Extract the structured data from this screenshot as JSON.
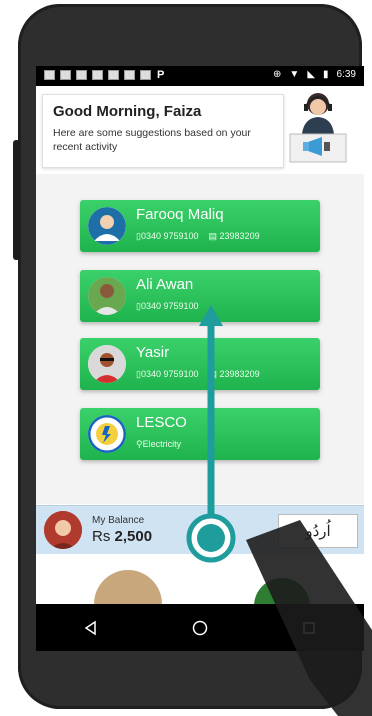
{
  "status_bar": {
    "time": "6:39"
  },
  "greeting": {
    "title": "Good Morning, Faiza",
    "subtitle": "Here are some suggestions based on your recent activity"
  },
  "contacts": [
    {
      "name": "Farooq Maliq",
      "phone": "0340 9759100",
      "account": "23983209"
    },
    {
      "name": "Ali Awan",
      "phone": "0340 9759100",
      "account": ""
    },
    {
      "name": "Yasir",
      "phone": "0340 9759100",
      "account": "23983209"
    },
    {
      "name": "LESCO",
      "category": "Electricity"
    }
  ],
  "balance": {
    "label": "My Balance",
    "currency": "Rs",
    "amount": "2,500"
  },
  "language_button": {
    "label": "اُردُو"
  },
  "nav": {
    "back": "back-icon",
    "home": "home-icon",
    "recents": "recents-icon"
  },
  "colors": {
    "accent_green": "#27c25a",
    "gesture_teal": "#1f9c9c",
    "balance_bar": "#cfe3f3"
  }
}
